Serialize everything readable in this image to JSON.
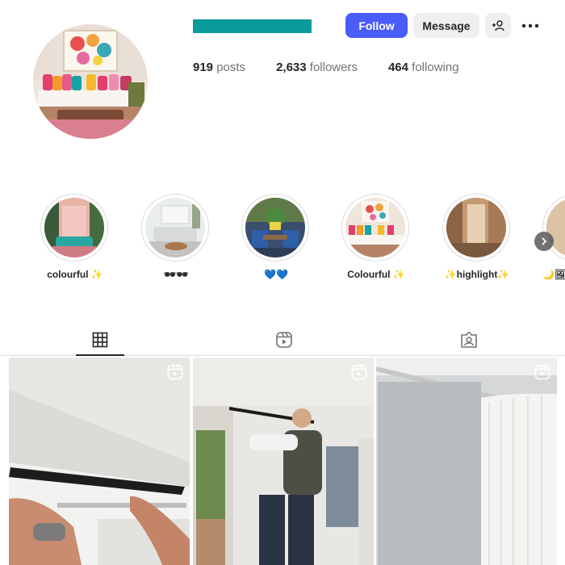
{
  "profile": {
    "accent_color": "#0b9a9a",
    "follow_label": "Follow",
    "message_label": "Message",
    "follow_color": "#4a5df9"
  },
  "stats": [
    {
      "value": "919",
      "label": "posts"
    },
    {
      "value": "2,633",
      "label": "followers"
    },
    {
      "value": "464",
      "label": "following"
    }
  ],
  "highlights": [
    {
      "label": "colourful ✨"
    },
    {
      "label": "🕶🕶"
    },
    {
      "label": "💙💙"
    },
    {
      "label": "Colourful ✨"
    },
    {
      "label": "✨highlight✨"
    },
    {
      "label": "🌙🖼"
    }
  ],
  "tabs": [
    {
      "name": "posts",
      "icon": "grid-icon",
      "active": true
    },
    {
      "name": "reels",
      "icon": "reels-icon",
      "active": false
    },
    {
      "name": "tagged",
      "icon": "tagged-icon",
      "active": false
    }
  ],
  "posts": [
    {
      "type": "reel",
      "icon": "reel-icon"
    },
    {
      "type": "reel",
      "icon": "reel-icon"
    },
    {
      "type": "reel",
      "icon": "reel-icon"
    }
  ]
}
